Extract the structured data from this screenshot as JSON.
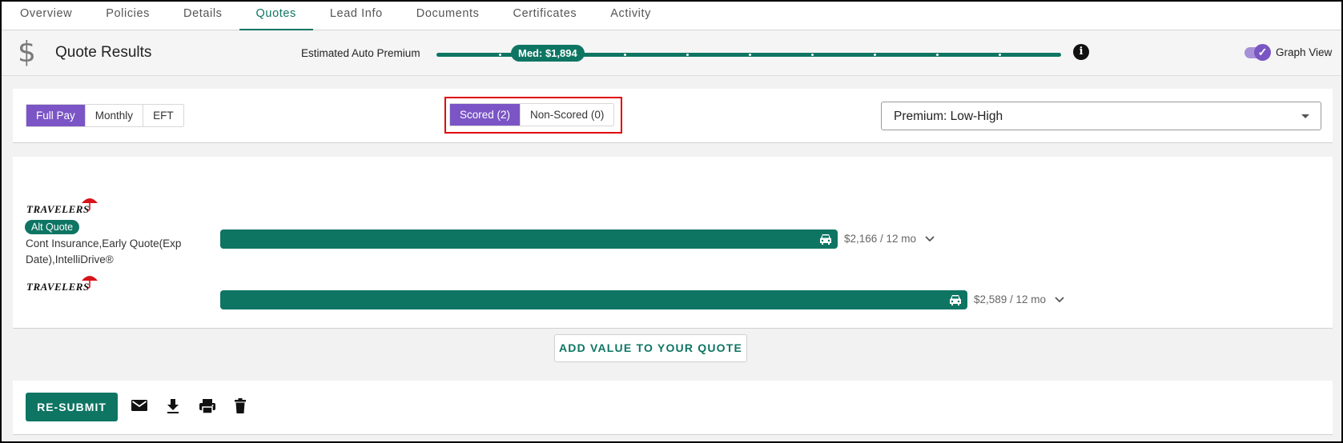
{
  "tabs": [
    {
      "label": "Overview"
    },
    {
      "label": "Policies"
    },
    {
      "label": "Details"
    },
    {
      "label": "Quotes"
    },
    {
      "label": "Lead Info"
    },
    {
      "label": "Documents"
    },
    {
      "label": "Certificates"
    },
    {
      "label": "Activity"
    }
  ],
  "active_tab": "Quotes",
  "header": {
    "title": "Quote Results",
    "icon": "dollar-icon",
    "estimated_label": "Estimated Auto Premium",
    "median_badge": "Med: $1,894",
    "graph_view_label": "Graph View",
    "graph_view_on": true
  },
  "payment_options": {
    "items": [
      "Full Pay",
      "Monthly",
      "EFT"
    ],
    "selected": "Full Pay"
  },
  "score_options": {
    "items": [
      "Scored (2)",
      "Non-Scored (0)"
    ],
    "selected": "Scored (2)"
  },
  "sort": {
    "value": "Premium: Low-High"
  },
  "quotes": [
    {
      "carrier": "TRAVELERS",
      "badge": "Alt Quote",
      "description": "Cont Insurance,Early Quote(Exp Date),IntelliDrive®",
      "premium": 2166,
      "price_label": "$2,166 / 12 mo"
    },
    {
      "carrier": "TRAVELERS",
      "badge": "",
      "description": "",
      "premium": 2589,
      "price_label": "$2,589 / 12 mo"
    }
  ],
  "add_value_label": "ADD VALUE TO YOUR QUOTE",
  "actions": {
    "resubmit_label": "RE-SUBMIT",
    "icons": [
      "email-icon",
      "download-icon",
      "print-icon",
      "delete-icon"
    ]
  },
  "colors": {
    "primary": "#0e7563",
    "accent": "#7b55c6",
    "highlight": "#e00000"
  }
}
